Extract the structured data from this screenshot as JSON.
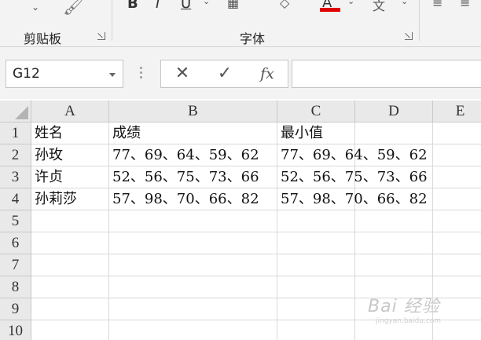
{
  "ribbon": {
    "groups": [
      {
        "label": "剪贴板"
      },
      {
        "label": "字体"
      }
    ],
    "font_color_bar": "#e00000"
  },
  "formula_bar": {
    "name_box": "G12",
    "cancel_glyph": "✕",
    "enter_glyph": "✓",
    "fx_label": "fx",
    "formula_value": ""
  },
  "grid": {
    "columns": [
      "A",
      "B",
      "C",
      "D",
      "E"
    ],
    "rows": [
      "1",
      "2",
      "3",
      "4",
      "5",
      "6",
      "7",
      "8",
      "9",
      "10"
    ],
    "cells": {
      "A1": "姓名",
      "B1": "成绩",
      "C1": "最小值",
      "A2": "孙玫",
      "B2": "77、69、64、59、62",
      "C2": "77、69、64、59、62",
      "A3": "许贞",
      "B3": "52、56、75、73、66",
      "C3": "52、56、75、73、66",
      "A4": "孙莉莎",
      "B4": "57、98、70、66、82",
      "C4": "57、98、70、66、82"
    }
  },
  "watermark": {
    "text": "Bai 经验",
    "sub": "jingyan.baidu.com"
  }
}
